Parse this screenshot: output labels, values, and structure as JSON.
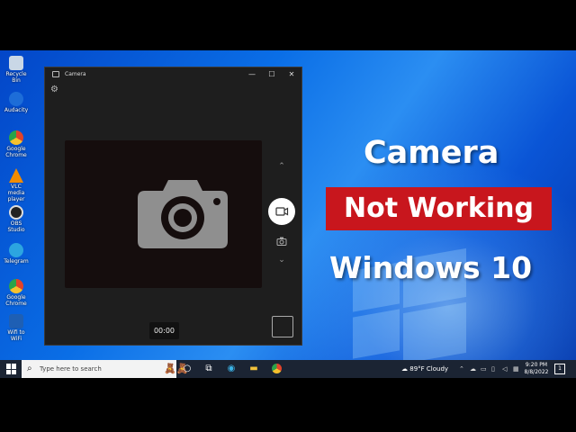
{
  "desktop": {
    "icons": [
      {
        "label": "Recycle Bin",
        "icon": "recycle-bin-icon",
        "color": "#c9d7e6"
      },
      {
        "label": "Audacity",
        "icon": "audacity-icon",
        "color": "#1d6dd8"
      },
      {
        "label": "Google Chrome",
        "icon": "chrome-icon",
        "color": "#e2432a"
      },
      {
        "label": "VLC media player",
        "icon": "vlc-icon",
        "color": "#f28c00"
      },
      {
        "label": "OBS Studio",
        "icon": "obs-icon",
        "color": "#222222"
      },
      {
        "label": "Telegram",
        "icon": "telegram-icon",
        "color": "#2ca5e0"
      },
      {
        "label": "Google Chrome",
        "icon": "chrome-icon",
        "color": "#e2432a"
      },
      {
        "label": "Wifi to WiFi",
        "icon": "app-icon",
        "color": "#1e5fb4"
      }
    ]
  },
  "camera_window": {
    "title": "Camera",
    "minimize": "—",
    "maximize": "☐",
    "close": "✕",
    "timer": "00:00",
    "icons": [
      "settings-icon",
      "camera-icon",
      "video-icon",
      "photo-mode-icon",
      "chevron-up-icon",
      "chevron-down-icon"
    ]
  },
  "headline": {
    "line1": "Camera",
    "line2": "Not Working",
    "line3": "Windows 10",
    "line2_bg": "#c8161d"
  },
  "taskbar": {
    "search_placeholder": "Type here to search",
    "weather_temp": "89°F",
    "weather_desc": "Cloudy",
    "clock_time": "9:20 PM",
    "clock_date": "8/8/2022",
    "notification_count": "1",
    "background": "#1b2433"
  }
}
